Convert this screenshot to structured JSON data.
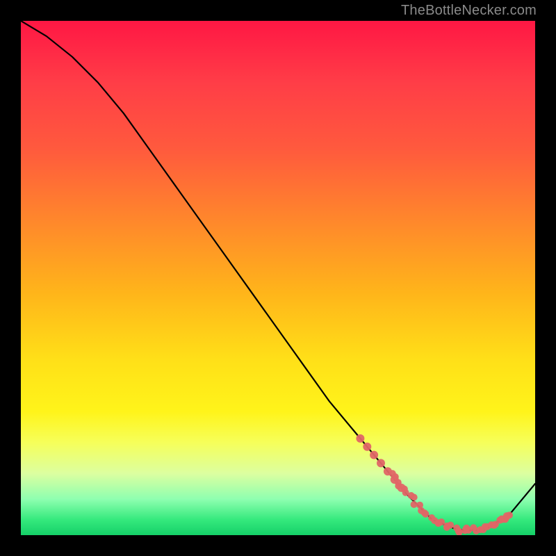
{
  "watermark": "TheBottleNecker.com",
  "chart_data": {
    "type": "line",
    "title": "",
    "xlabel": "",
    "ylabel": "",
    "xlim": [
      0,
      100
    ],
    "ylim": [
      0,
      100
    ],
    "x": [
      0,
      5,
      10,
      15,
      20,
      25,
      30,
      35,
      40,
      45,
      50,
      55,
      60,
      65,
      70,
      75,
      80,
      85,
      90,
      95,
      100
    ],
    "values": [
      100,
      97,
      93,
      88,
      82,
      75,
      68,
      61,
      54,
      47,
      40,
      33,
      26,
      20,
      14,
      8,
      3,
      1,
      1,
      4,
      10
    ],
    "cluster_x_range": [
      72,
      95
    ],
    "cluster_y_range": [
      0,
      14
    ],
    "dot_color": "#e06666",
    "line_color": "#000000"
  }
}
